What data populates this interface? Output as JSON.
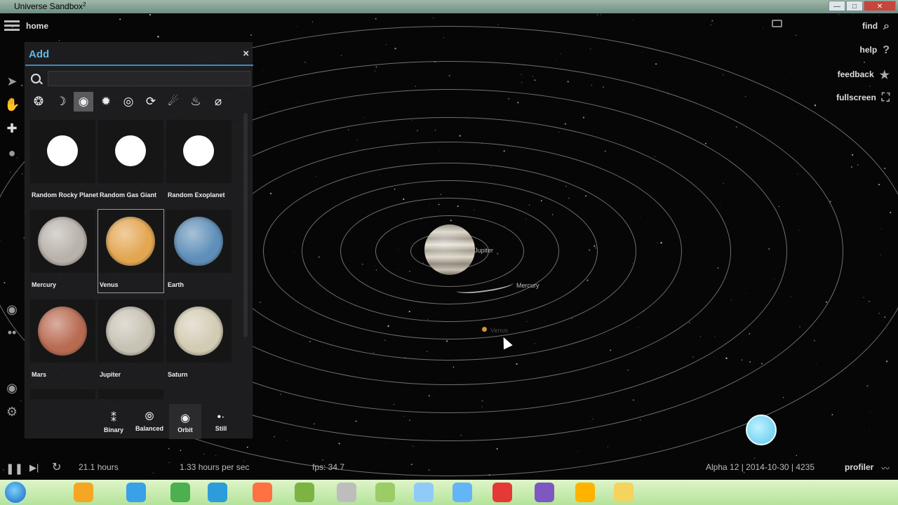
{
  "window": {
    "title": "Universe Sandbox",
    "title_sup": "2"
  },
  "topbar": {
    "home_label": "home"
  },
  "right_menu": [
    {
      "label": "find",
      "icon": "search-icon"
    },
    {
      "label": "help",
      "icon": "question-icon"
    },
    {
      "label": "feedback",
      "icon": "star-icon"
    },
    {
      "label": "fullscreen",
      "icon": "fullscreen-icon"
    }
  ],
  "left_tools": [
    "pointer-icon",
    "hand-icon",
    "add-icon",
    "drop-icon",
    "orbit-view-icon",
    "dots-icon",
    "eye-icon",
    "gear-icon"
  ],
  "add_panel": {
    "title": "Add",
    "close_label": "×",
    "search_placeholder": "",
    "categories": [
      {
        "name": "systems",
        "glyph": "❂"
      },
      {
        "name": "moons",
        "glyph": "☽"
      },
      {
        "name": "planets",
        "glyph": "◉",
        "active": true
      },
      {
        "name": "stars",
        "glyph": "✹"
      },
      {
        "name": "galaxies",
        "glyph": "◎"
      },
      {
        "name": "black-holes",
        "glyph": "⟳"
      },
      {
        "name": "comets",
        "glyph": "☄"
      },
      {
        "name": "objects",
        "glyph": "♨"
      },
      {
        "name": "tools",
        "glyph": "⌀"
      }
    ],
    "items": [
      {
        "label": "Random Rocky Planet",
        "kind": "orb"
      },
      {
        "label": "Random Gas Giant",
        "kind": "orb"
      },
      {
        "label": "Random Exoplanet",
        "kind": "orb"
      },
      {
        "label": "Mercury",
        "kind": "planet",
        "color": "#b9b2aa"
      },
      {
        "label": "Venus",
        "kind": "planet",
        "color": "#e3a651",
        "selected": true
      },
      {
        "label": "Earth",
        "kind": "planet",
        "color": "#5f8fb8"
      },
      {
        "label": "Mars",
        "kind": "planet",
        "color": "#b96b52"
      },
      {
        "label": "Jupiter",
        "kind": "planet",
        "color": "#c8c2b4"
      },
      {
        "label": "Saturn",
        "kind": "planet",
        "color": "#d3ccb4"
      }
    ],
    "modes": [
      {
        "label": "Binary",
        "glyph": "⁑"
      },
      {
        "label": "Balanced",
        "glyph": "⦾"
      },
      {
        "label": "Orbit",
        "glyph": "◉",
        "active": true
      },
      {
        "label": "Still",
        "glyph": "•·"
      }
    ]
  },
  "scene": {
    "labels": {
      "jupiter": "Jupiter",
      "mercury": "Mercury",
      "venus": "Venus"
    }
  },
  "status_bar": {
    "elapsed": "21.1 hours",
    "rate": "1.33 hours per sec",
    "fps": "fps: 34.7",
    "version": "Alpha 12 | 2014-10-30 | 4235",
    "profiler": "profiler"
  },
  "colors": {
    "accent": "#5fb7e8",
    "panel_bg": "#1e1e20",
    "taskbar": "#c8eeb0"
  }
}
